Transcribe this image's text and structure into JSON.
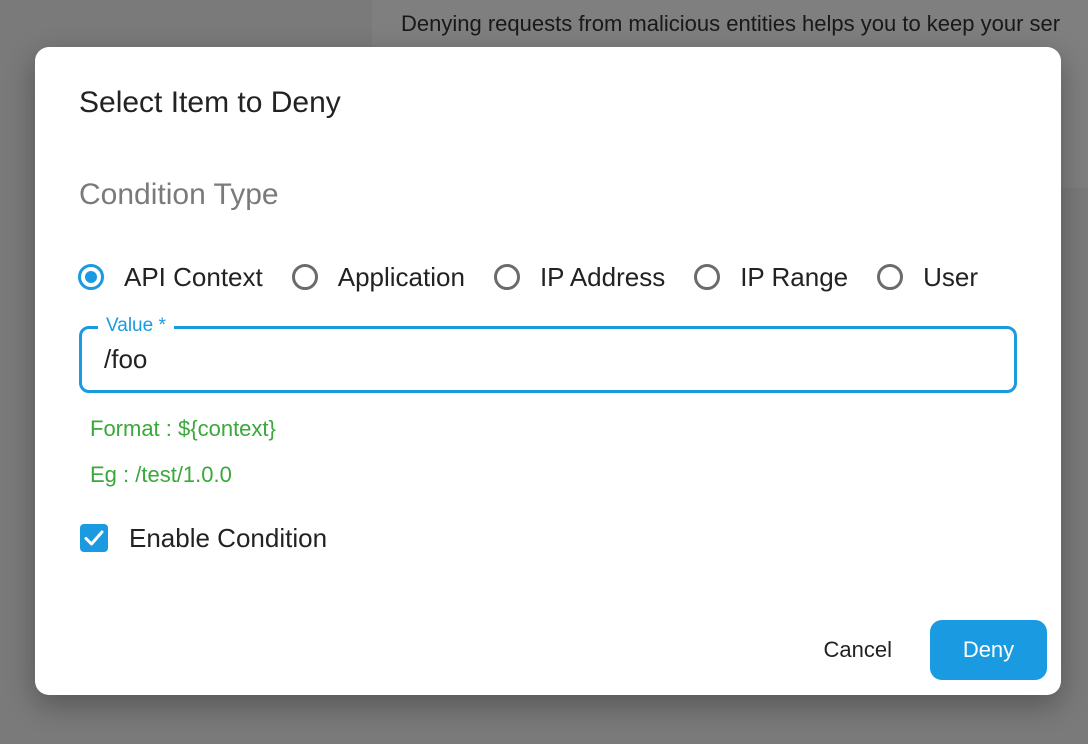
{
  "background": {
    "description_text": "Denying requests from malicious entities helps you to keep your ser"
  },
  "dialog": {
    "title": "Select Item to Deny",
    "section_title": "Condition Type",
    "condition_types": [
      {
        "label": "API Context",
        "checked": true
      },
      {
        "label": "Application",
        "checked": false
      },
      {
        "label": "IP Address",
        "checked": false
      },
      {
        "label": "IP Range",
        "checked": false
      },
      {
        "label": "User",
        "checked": false
      }
    ],
    "value_field": {
      "label": "Value",
      "required_marker": "*",
      "value": "/foo"
    },
    "format_hint": "Format : ${context}",
    "example_hint": "Eg : /test/1.0.0",
    "enable_condition": {
      "label": "Enable Condition",
      "checked": true
    },
    "cancel_label": "Cancel",
    "deny_label": "Deny"
  },
  "colors": {
    "accent": "#1a9ae0",
    "hint_green": "#3aa83a",
    "backdrop": "rgba(0,0,0,0.5)"
  },
  "icons": {
    "checkbox": "check-icon",
    "radio_selected": "radio-selected-icon",
    "radio_unselected": "radio-unselected-icon"
  }
}
